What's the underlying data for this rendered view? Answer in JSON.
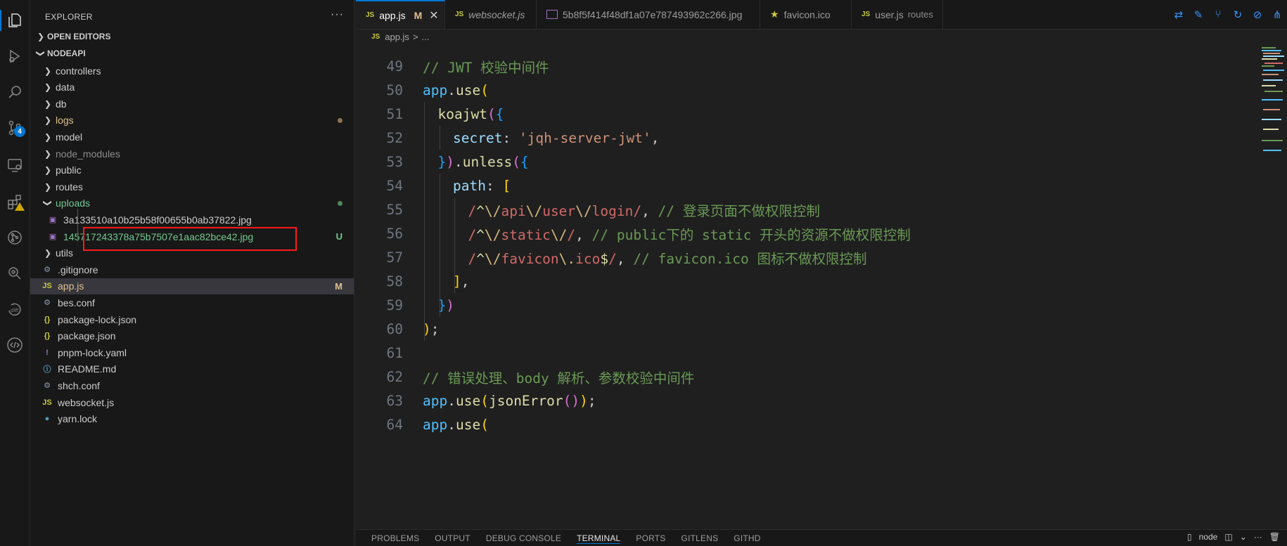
{
  "explorer": {
    "title": "EXPLORER",
    "more": "···",
    "open_editors_label": "OPEN EDITORS",
    "project_label": "NODEAPI",
    "rows": [
      {
        "kind": "folder",
        "label": "controllers",
        "color": "#cccccc"
      },
      {
        "kind": "folder",
        "label": "data",
        "color": "#cccccc"
      },
      {
        "kind": "folder",
        "label": "db",
        "color": "#cccccc"
      },
      {
        "kind": "folder",
        "label": "logs",
        "color": "#e2c08d",
        "decoration": "dot",
        "decoration_color": "#8b7355"
      },
      {
        "kind": "folder",
        "label": "model",
        "color": "#cccccc"
      },
      {
        "kind": "folder",
        "label": "node_modules",
        "color": "#8c8c8c"
      },
      {
        "kind": "folder",
        "label": "public",
        "color": "#cccccc"
      },
      {
        "kind": "folder",
        "label": "routes",
        "color": "#cccccc"
      },
      {
        "kind": "folder-open",
        "label": "uploads",
        "color": "#73c991",
        "decoration": "dot",
        "decoration_color": "#4f8a5a"
      },
      {
        "kind": "image",
        "label": "3a133510a10b25b58f00655b0ab37822.jpg",
        "color": "#cccccc"
      },
      {
        "kind": "image",
        "label": "145717243378a75b7507e1aac82bce42.jpg",
        "color": "#73c991",
        "decoration": "letter",
        "decoration_text": "U",
        "decoration_color": "#73c991"
      },
      {
        "kind": "folder",
        "label": "utils",
        "color": "#cccccc"
      },
      {
        "kind": "gear",
        "label": ".gitignore",
        "color": "#cccccc"
      },
      {
        "kind": "js",
        "label": "app.js",
        "color": "#e2c08d",
        "selected": true,
        "decoration": "letter",
        "decoration_text": "M",
        "decoration_color": "#e2c08d"
      },
      {
        "kind": "gear",
        "label": "bes.conf",
        "color": "#cccccc"
      },
      {
        "kind": "json",
        "label": "package-lock.json",
        "color": "#cccccc"
      },
      {
        "kind": "json",
        "label": "package.json",
        "color": "#cccccc"
      },
      {
        "kind": "yaml",
        "label": "pnpm-lock.yaml",
        "color": "#cccccc"
      },
      {
        "kind": "info",
        "label": "README.md",
        "color": "#cccccc"
      },
      {
        "kind": "gear",
        "label": "shch.conf",
        "color": "#cccccc"
      },
      {
        "kind": "js",
        "label": "websocket.js",
        "color": "#cccccc"
      },
      {
        "kind": "yarn",
        "label": "yarn.lock",
        "color": "#cccccc"
      }
    ]
  },
  "tabs": [
    {
      "icon": "js",
      "label": "app.js",
      "active": true,
      "modified": "M",
      "close": "✕"
    },
    {
      "icon": "js",
      "label": "websocket.js",
      "italic": true
    },
    {
      "icon": "image",
      "label": "5b8f5f414f48df1a07e787493962c266.jpg"
    },
    {
      "icon": "star",
      "label": "favicon.ico"
    },
    {
      "icon": "js",
      "label": "user.js",
      "sub": "routes"
    }
  ],
  "breadcrumb": {
    "icon": "JS",
    "file": "app.js",
    "sep": ">",
    "more": "..."
  },
  "code_lines": [
    {
      "n": "49",
      "indent": 0,
      "tokens": [
        [
          "c-comment",
          "// JWT 校验中间件"
        ]
      ]
    },
    {
      "n": "50",
      "indent": 0,
      "tokens": [
        [
          "c-var",
          "app"
        ],
        [
          "c-punc",
          "."
        ],
        [
          "c-fn",
          "use"
        ],
        [
          "c-brk1",
          "("
        ]
      ]
    },
    {
      "n": "51",
      "indent": 1,
      "tokens": [
        [
          "c-fn",
          "koajwt"
        ],
        [
          "c-brk2",
          "("
        ],
        [
          "c-brk3",
          "{"
        ]
      ]
    },
    {
      "n": "52",
      "indent": 2,
      "tokens": [
        [
          "c-prop",
          "secret"
        ],
        [
          "c-punc",
          ": "
        ],
        [
          "c-str",
          "'jqh-server-jwt'"
        ],
        [
          "c-punc",
          ","
        ]
      ]
    },
    {
      "n": "53",
      "indent": 1,
      "tokens": [
        [
          "c-brk3",
          "}"
        ],
        [
          "c-brk2",
          ")"
        ],
        [
          "c-punc",
          "."
        ],
        [
          "c-fn",
          "unless"
        ],
        [
          "c-brk2",
          "("
        ],
        [
          "c-brk3",
          "{"
        ]
      ]
    },
    {
      "n": "54",
      "indent": 2,
      "tokens": [
        [
          "c-prop",
          "path"
        ],
        [
          "c-punc",
          ": "
        ],
        [
          "c-brk1",
          "["
        ]
      ]
    },
    {
      "n": "55",
      "indent": 3,
      "tokens": [
        [
          "c-re",
          "/"
        ],
        [
          "c-reop",
          "^"
        ],
        [
          "c-reesc",
          "\\/"
        ],
        [
          "c-re",
          "api"
        ],
        [
          "c-reesc",
          "\\/"
        ],
        [
          "c-re",
          "user"
        ],
        [
          "c-reesc",
          "\\/"
        ],
        [
          "c-re",
          "login/"
        ],
        [
          "c-punc",
          ", "
        ],
        [
          "c-comment",
          "// 登录页面不做权限控制"
        ]
      ]
    },
    {
      "n": "56",
      "indent": 3,
      "tokens": [
        [
          "c-re",
          "/"
        ],
        [
          "c-reop",
          "^"
        ],
        [
          "c-reesc",
          "\\/"
        ],
        [
          "c-re",
          "static"
        ],
        [
          "c-reesc",
          "\\/"
        ],
        [
          "c-re",
          "/"
        ],
        [
          "c-punc",
          ", "
        ],
        [
          "c-comment",
          "// public下的 static 开头的资源不做权限控制"
        ]
      ]
    },
    {
      "n": "57",
      "indent": 3,
      "tokens": [
        [
          "c-re",
          "/"
        ],
        [
          "c-reop",
          "^"
        ],
        [
          "c-reesc",
          "\\/"
        ],
        [
          "c-re",
          "favicon"
        ],
        [
          "c-reesc",
          "\\."
        ],
        [
          "c-re",
          "ico"
        ],
        [
          "c-reop",
          "$"
        ],
        [
          "c-re",
          "/"
        ],
        [
          "c-punc",
          ", "
        ],
        [
          "c-comment",
          "// favicon.ico 图标不做权限控制"
        ]
      ]
    },
    {
      "n": "58",
      "indent": 2,
      "tokens": [
        [
          "c-brk1",
          "]"
        ],
        [
          "c-punc",
          ","
        ]
      ]
    },
    {
      "n": "59",
      "indent": 1,
      "tokens": [
        [
          "c-brk3",
          "}"
        ],
        [
          "c-brk2",
          ")"
        ]
      ]
    },
    {
      "n": "60",
      "indent": 0,
      "tokens": [
        [
          "c-brk1",
          ")"
        ],
        [
          "c-punc",
          ";"
        ]
      ]
    },
    {
      "n": "61",
      "indent": 0,
      "tokens": []
    },
    {
      "n": "62",
      "indent": 0,
      "tokens": [
        [
          "c-comment",
          "// 错误处理、body 解析、参数校验中间件"
        ]
      ]
    },
    {
      "n": "63",
      "indent": 0,
      "tokens": [
        [
          "c-var",
          "app"
        ],
        [
          "c-punc",
          "."
        ],
        [
          "c-fn",
          "use"
        ],
        [
          "c-brk1",
          "("
        ],
        [
          "c-fn",
          "jsonError"
        ],
        [
          "c-brk2",
          "()"
        ],
        [
          "c-brk1",
          ")"
        ],
        [
          "c-punc",
          ";"
        ]
      ]
    },
    {
      "n": "64",
      "indent": 0,
      "tokens": [
        [
          "c-var",
          "app"
        ],
        [
          "c-punc",
          "."
        ],
        [
          "c-fn",
          "use"
        ],
        [
          "c-brk1",
          "("
        ]
      ]
    }
  ],
  "panel": {
    "tabs": [
      "PROBLEMS",
      "OUTPUT",
      "DEBUG CONSOLE",
      "TERMINAL",
      "PORTS",
      "GITLENS",
      "GITHD"
    ],
    "active": "TERMINAL",
    "terminal_name": "node"
  },
  "activity_badges": {
    "source_control": "4"
  }
}
